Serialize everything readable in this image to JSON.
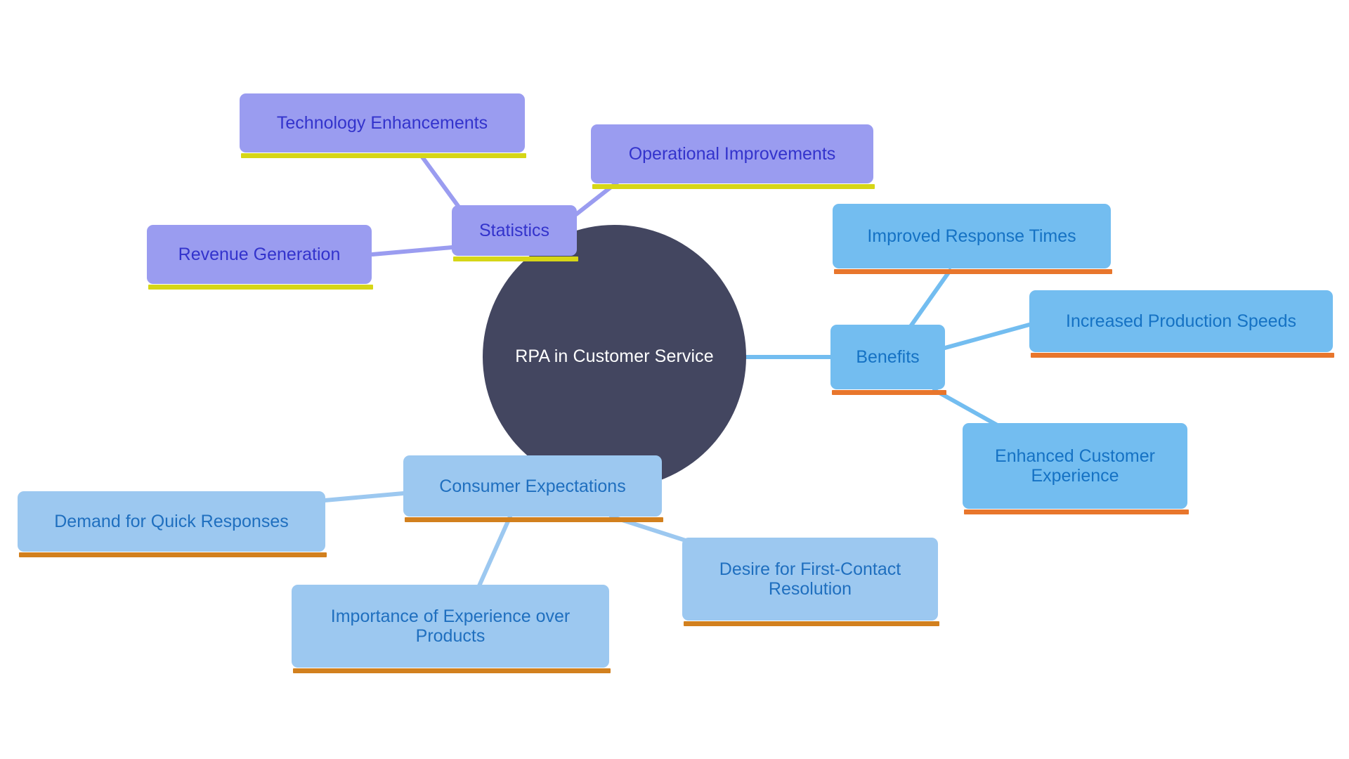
{
  "diagram": {
    "type": "mindmap",
    "title": "RPA in Customer Service",
    "background_color": "#ffffff",
    "root": {
      "label": "RPA in Customer Service",
      "fill_color": "#434660",
      "text_color": "#ffffff"
    },
    "branches": [
      {
        "id": "statistics",
        "label": "Statistics",
        "fill_color": "#9a9cf0",
        "text_color": "#3333cc",
        "accent_color": "#d6d617",
        "link_color": "#9a9cf0",
        "children": [
          {
            "label": "Technology Enhancements"
          },
          {
            "label": "Operational Improvements"
          },
          {
            "label": "Revenue Generation"
          }
        ]
      },
      {
        "id": "benefits",
        "label": "Benefits",
        "fill_color": "#73bdf0",
        "text_color": "#1572c4",
        "accent_color": "#e8762c",
        "link_color": "#73bdf0",
        "children": [
          {
            "label": "Improved Response Times"
          },
          {
            "label": "Increased Production Speeds"
          },
          {
            "label": "Enhanced Customer\nExperience"
          }
        ]
      },
      {
        "id": "consumer_expectations",
        "label": "Consumer Expectations",
        "fill_color": "#9cc8f0",
        "text_color": "#1f6fbf",
        "accent_color": "#d2801e",
        "link_color": "#9cc8f0",
        "children": [
          {
            "label": "Demand for Quick Responses"
          },
          {
            "label": "Importance of Experience over\nProducts"
          },
          {
            "label": "Desire for First-Contact\nResolution"
          }
        ]
      }
    ]
  }
}
